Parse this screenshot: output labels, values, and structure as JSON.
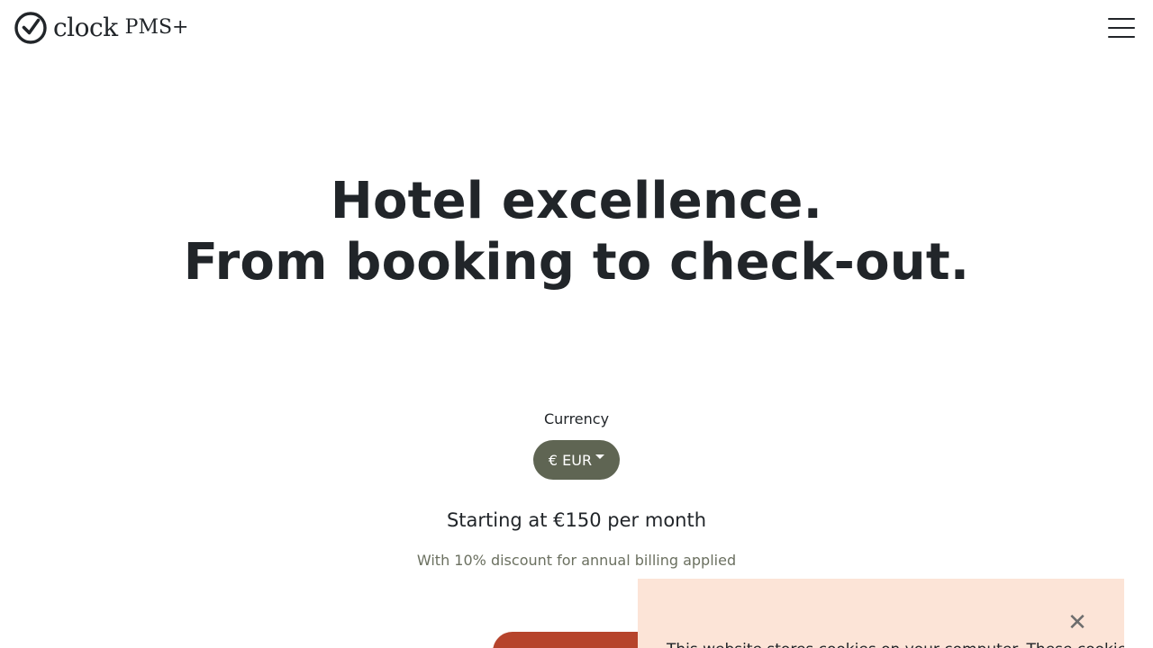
{
  "header": {
    "logo_text": "clock",
    "logo_suffix": "PMS+",
    "logo_icon": "clock-check-icon",
    "menu_icon": "hamburger-menu-icon"
  },
  "hero": {
    "line1": "Hotel excellence.",
    "line2": "From booking to check-out."
  },
  "pricing": {
    "currency_label": "Currency",
    "currency_selected": "€ EUR",
    "price_text": "Starting at €150 per month",
    "discount_text": "With 10% discount for annual billing applied"
  },
  "cookie_banner": {
    "close_icon": "close-icon",
    "text": "This website stores cookies on your computer. These cookies"
  },
  "colors": {
    "text": "#212529",
    "currency_button": "#5f6553",
    "muted_text": "#6b7060",
    "cta": "#b6442c",
    "cookie_bg": "#fce4d7"
  }
}
